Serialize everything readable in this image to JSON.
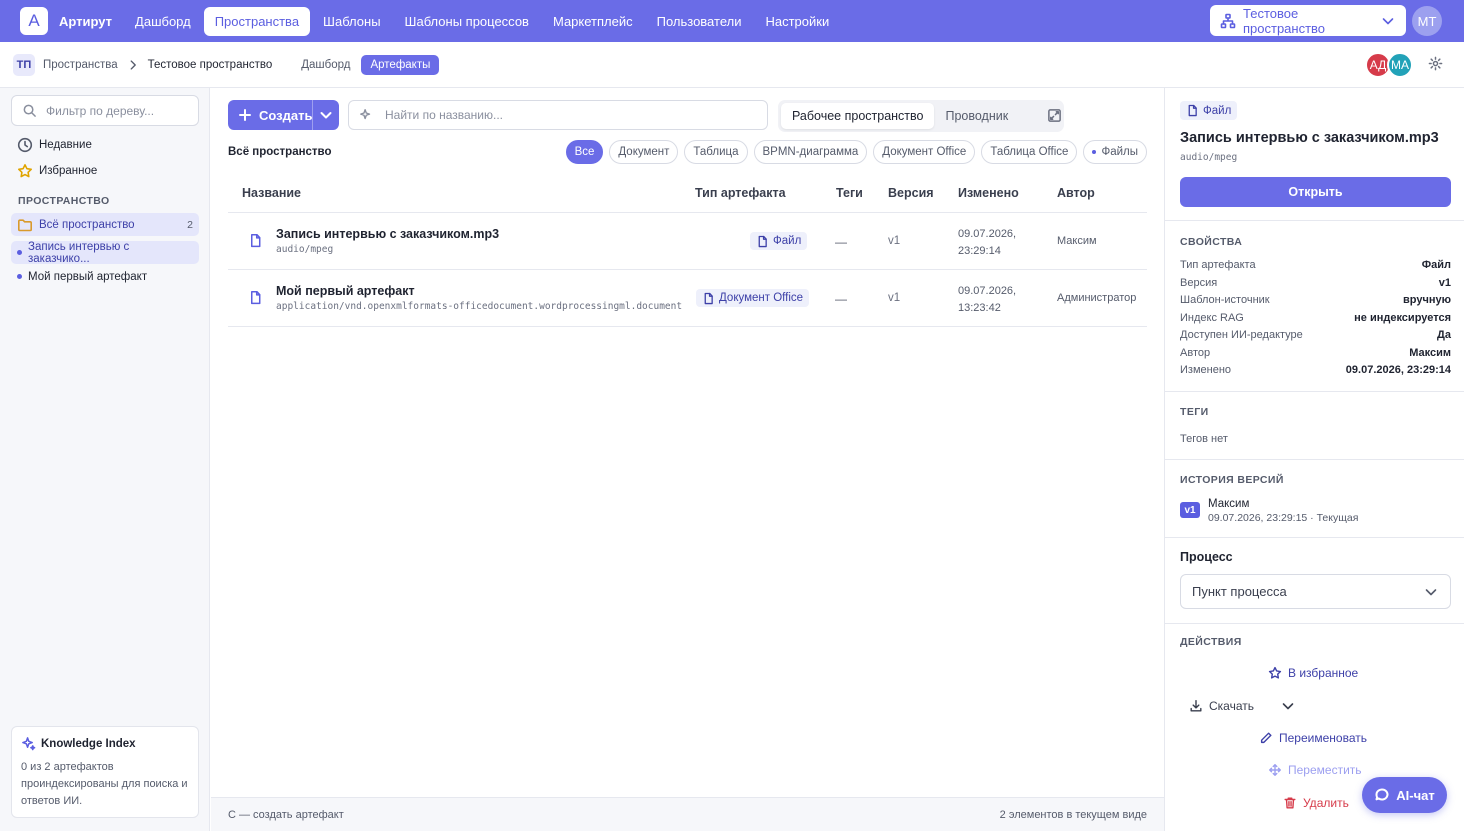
{
  "app": {
    "logo_letter": "A",
    "brand": "Артирут"
  },
  "nav": [
    {
      "label": "Дашборд",
      "active": false
    },
    {
      "label": "Пространства",
      "active": true
    },
    {
      "label": "Шаблоны",
      "active": false
    },
    {
      "label": "Шаблоны процессов",
      "active": false
    },
    {
      "label": "Маркетплейс",
      "active": false
    },
    {
      "label": "Пользователи",
      "active": false
    },
    {
      "label": "Настройки",
      "active": false
    }
  ],
  "space_select": {
    "value": "Тестовое пространство",
    "icon": "sitemap-icon"
  },
  "user": {
    "initials": "МТ"
  },
  "breadcrumb": {
    "badge": "ТП",
    "root": "Пространства",
    "current": "Тестовое пространство",
    "tabs": [
      {
        "label": "Дашборд",
        "active": false
      },
      {
        "label": "Артефакты",
        "active": true
      }
    ]
  },
  "members": [
    {
      "initials": "АД",
      "color": "#d63b4a"
    },
    {
      "initials": "МА",
      "color": "#22a2b8"
    }
  ],
  "sidebar": {
    "filter_placeholder": "Фильтр по дереву...",
    "recent": "Недавние",
    "favorites": "Избранное",
    "section": "ПРОСТРАНСТВО",
    "all_space": {
      "label": "Всё пространство",
      "count": "2"
    },
    "items": [
      {
        "label": "Запись интервью с заказчико..."
      },
      {
        "label": "Мой первый артефакт"
      }
    ],
    "knowledge": {
      "title": "Knowledge Index",
      "text": "0 из 2 артефактов проиндексированы для поиска и ответов ИИ."
    }
  },
  "toolbar": {
    "create_label": "Создать",
    "search_placeholder": "Найти по названию...",
    "views": [
      {
        "label": "Рабочее пространство",
        "active": true
      },
      {
        "label": "Проводник",
        "active": false
      }
    ]
  },
  "scope_label": "Всё пространство",
  "filters": [
    {
      "label": "Все",
      "active": true
    },
    {
      "label": "Документ",
      "active": false
    },
    {
      "label": "Таблица",
      "active": false
    },
    {
      "label": "BPMN-диаграмма",
      "active": false
    },
    {
      "label": "Документ Office",
      "active": false
    },
    {
      "label": "Таблица Office",
      "active": false
    },
    {
      "label": "Файлы",
      "active": false
    }
  ],
  "table": {
    "columns": [
      "Название",
      "Тип артефакта",
      "Теги",
      "Версия",
      "Изменено",
      "Автор"
    ],
    "rows": [
      {
        "name": "Запись интервью с заказчиком.mp3",
        "mime": "audio/mpeg",
        "type": "Файл",
        "tags": "—",
        "version": "v1",
        "date": "09.07.2026,",
        "time": "23:29:14",
        "author": "Максим"
      },
      {
        "name": "Мой первый артефакт",
        "mime": "application/vnd.openxmlformats-officedocument.wordprocessingml.document",
        "type": "Документ Office",
        "tags": "—",
        "version": "v1",
        "date": "09.07.2026,",
        "time": "13:23:42",
        "author": "Администратор"
      }
    ]
  },
  "footer": {
    "hint": "C — создать артефакт",
    "count": "2 элементов в текущем виде"
  },
  "details": {
    "badge": "Файл",
    "title": "Запись интервью с заказчиком.mp3",
    "mime": "audio/mpeg",
    "open_label": "Открыть",
    "props_header": "СВОЙСТВА",
    "props": [
      {
        "k": "Тип артефакта",
        "v": "Файл"
      },
      {
        "k": "Версия",
        "v": "v1"
      },
      {
        "k": "Шаблон-источник",
        "v": "вручную"
      },
      {
        "k": "Индекс RAG",
        "v": "не индексируется"
      },
      {
        "k": "Доступен ИИ-редактуре",
        "v": "Да"
      },
      {
        "k": "Автор",
        "v": "Максим"
      },
      {
        "k": "Изменено",
        "v": "09.07.2026, 23:29:14"
      }
    ],
    "tags_header": "ТЕГИ",
    "tags_empty": "Тегов нет",
    "history_header": "ИСТОРИЯ ВЕРСИЙ",
    "history": {
      "badge": "v1",
      "author": "Максим",
      "when": "09.07.2026, 23:29:15 · Текущая"
    },
    "process_header": "Процесс",
    "process_placeholder": "Пункт процесса",
    "actions_header": "ДЕЙСТВИЯ",
    "actions": {
      "favorite": "В избранное",
      "download": "Скачать",
      "rename": "Переименовать",
      "move": "Переместить",
      "delete": "Удалить"
    }
  },
  "ai_chat": {
    "label": "AI-чат"
  },
  "colors": {
    "accent": "#6a6ce7",
    "danger": "#d63b4a"
  }
}
